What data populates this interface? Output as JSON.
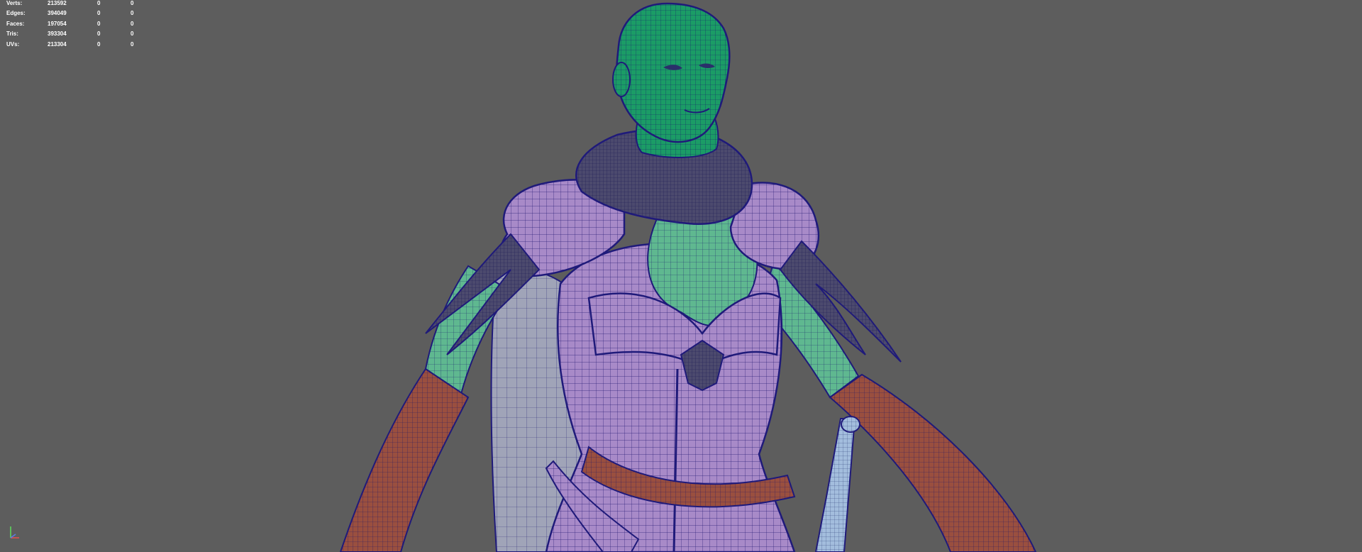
{
  "heads_up_display": {
    "rows": [
      {
        "label": "Verts:",
        "total": "213592",
        "selected": "0",
        "highlighted": "0"
      },
      {
        "label": "Edges:",
        "total": "394049",
        "selected": "0",
        "highlighted": "0"
      },
      {
        "label": "Faces:",
        "total": "197054",
        "selected": "0",
        "highlighted": "0"
      },
      {
        "label": "Tris:",
        "total": "393304",
        "selected": "0",
        "highlighted": "0"
      },
      {
        "label": "UVs:",
        "total": "213304",
        "selected": "0",
        "highlighted": "0"
      }
    ]
  },
  "colors": {
    "viewport_background": "#5d5d5d",
    "skin_green": "#1fa36a",
    "armor_purple": "#a586c6",
    "leather_red": "#9a4f3f",
    "cloak_gray": "#8a8fa6",
    "wireframe": "#1f1a7a",
    "sword_blue": "#9fb8da"
  }
}
